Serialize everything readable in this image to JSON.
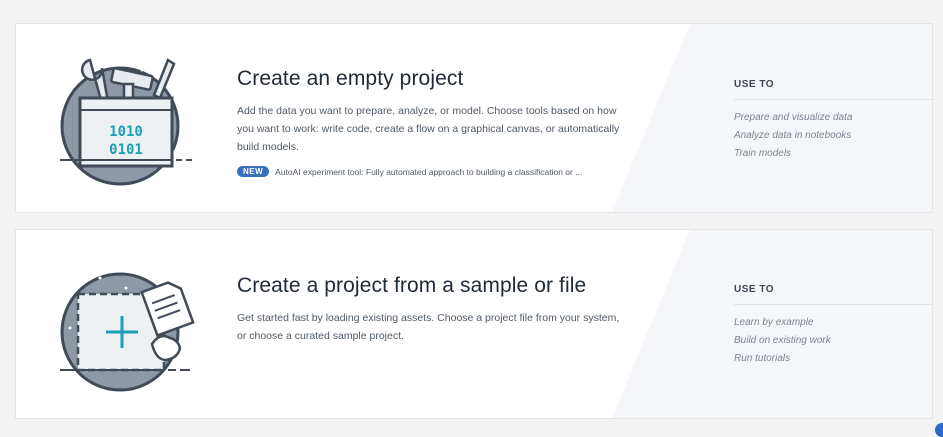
{
  "cards": [
    {
      "title": "Create an empty project",
      "description": "Add the data you want to prepare, analyze, or model. Choose tools based on how you want to work: write code, create a flow on a graphical canvas, or automatically build models.",
      "badge": "NEW",
      "badge_text": "AutoAI experiment tool: Fully automated approach to building a classification or ...",
      "use_to_label": "USE TO",
      "use_to_items": [
        "Prepare and visualize data",
        "Analyze data in notebooks",
        "Train models"
      ],
      "illustration_text": [
        "1010",
        "0101"
      ]
    },
    {
      "title": "Create a project from a sample or file",
      "description": "Get started fast by loading existing assets. Choose a project file from your system, or choose a curated sample project.",
      "use_to_label": "USE TO",
      "use_to_items": [
        "Learn by example",
        "Build on existing work",
        "Run tutorials"
      ]
    }
  ],
  "colors": {
    "accent": "#3a6fbe",
    "illustration_teal": "#1aa0b5",
    "illustration_gray": "#8f99a6"
  },
  "icons": {
    "card1": "tools-binary-icon",
    "card2": "add-file-icon"
  }
}
